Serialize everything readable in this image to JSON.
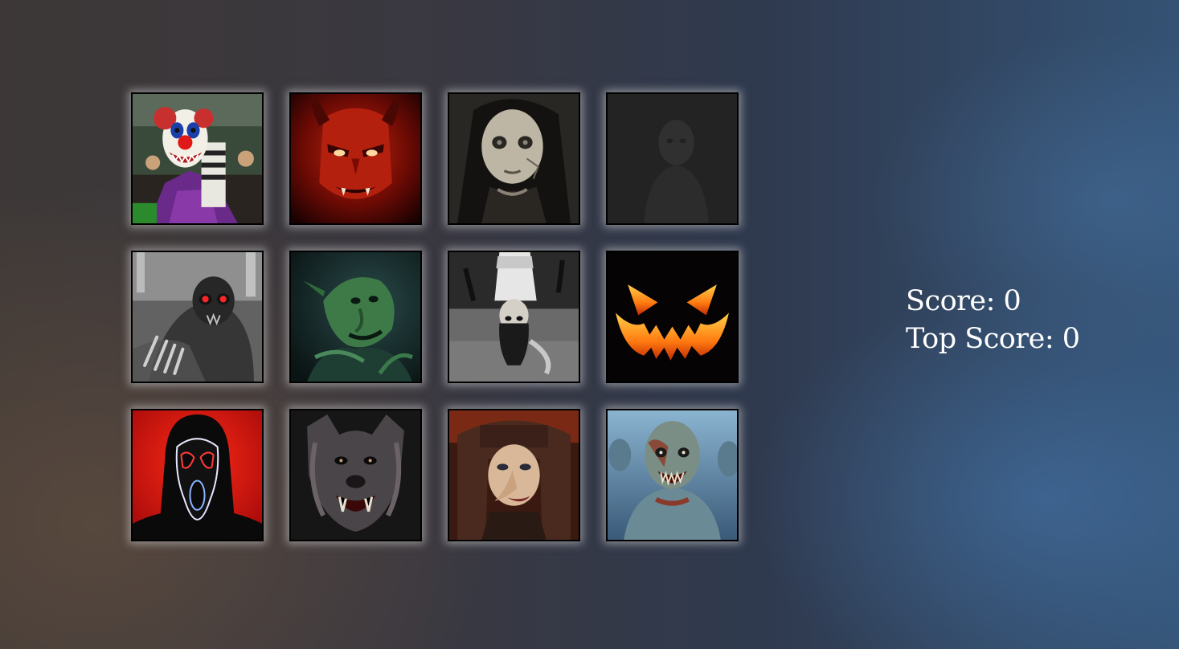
{
  "scoreboard": {
    "score_label": "Score:",
    "score_value": "0",
    "top_score_label": "Top Score:",
    "top_score_value": "0"
  },
  "cards": [
    {
      "subject": "clown"
    },
    {
      "subject": "red-devil"
    },
    {
      "subject": "creepy-doll"
    },
    {
      "subject": "ghost"
    },
    {
      "subject": "red-eyed-skull-demon"
    },
    {
      "subject": "green-goblin"
    },
    {
      "subject": "upside-down-girl"
    },
    {
      "subject": "jack-o-lantern"
    },
    {
      "subject": "scream-mask"
    },
    {
      "subject": "werewolf"
    },
    {
      "subject": "witch"
    },
    {
      "subject": "zombie"
    }
  ]
}
